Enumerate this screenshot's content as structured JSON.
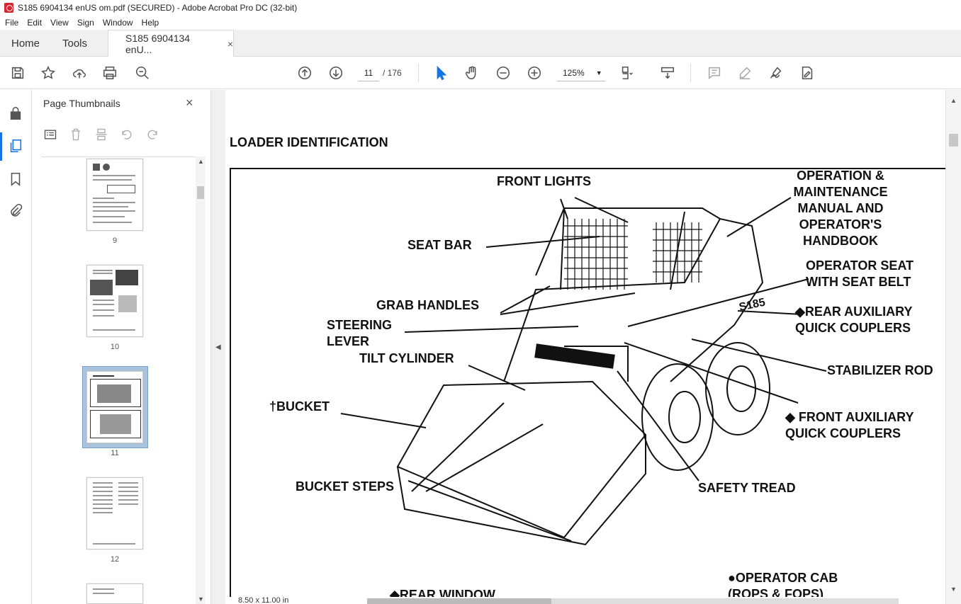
{
  "window": {
    "title": "S185 6904134 enUS om.pdf (SECURED) - Adobe Acrobat Pro DC (32-bit)"
  },
  "menu": [
    "File",
    "Edit",
    "View",
    "Sign",
    "Window",
    "Help"
  ],
  "tabs": {
    "home": "Home",
    "tools": "Tools",
    "doc": "S185 6904134 enU...",
    "close": "×"
  },
  "toolbar": {
    "page_current": "11",
    "page_total": "/ 176",
    "zoom": "125%"
  },
  "thumbnails": {
    "title": "Page Thumbnails",
    "close": "×",
    "pages": [
      "9",
      "10",
      "11",
      "12"
    ],
    "selected": "11"
  },
  "document": {
    "heading": "LOADER IDENTIFICATION",
    "labels": {
      "front_lights": "FRONT LIGHTS",
      "operation_manual": [
        "OPERATION &",
        "MAINTENANCE",
        "MANUAL AND",
        "OPERATOR'S",
        "HANDBOOK"
      ],
      "seat_bar": "SEAT BAR",
      "operator_seat": [
        "OPERATOR SEAT",
        "WITH SEAT BELT"
      ],
      "grab_handles": "GRAB HANDLES",
      "rear_aux": [
        "◆REAR AUXILIARY",
        "QUICK COUPLERS"
      ],
      "steering_lever": [
        "STEERING",
        "LEVER"
      ],
      "tilt_cylinder": "TILT CYLINDER",
      "stabilizer_rod": "STABILIZER ROD",
      "bucket": "†BUCKET",
      "front_aux": [
        "◆  FRONT AUXILIARY",
        "QUICK COUPLERS"
      ],
      "bucket_steps": "BUCKET STEPS",
      "safety_tread": "SAFETY TREAD",
      "operator_cab": [
        "●OPERATOR CAB",
        "(ROPS & FOPS)"
      ],
      "rear_window": "◆REAR WINDOW",
      "decal": "S185"
    }
  },
  "status": {
    "page_size": "8.50 x 11.00 in"
  }
}
